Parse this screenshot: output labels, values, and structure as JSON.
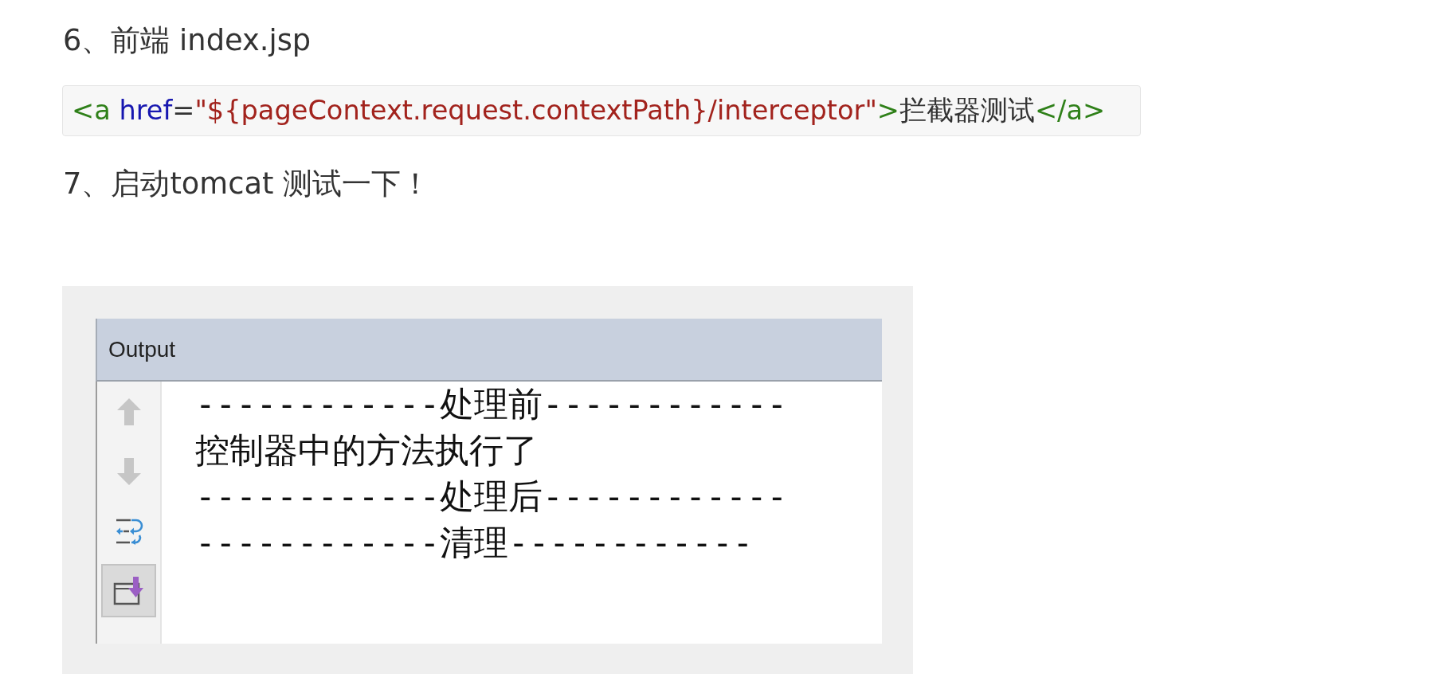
{
  "sections": [
    {
      "heading": "6、前端 index.jsp",
      "code": [
        {
          "kind": "tag",
          "text": "<a"
        },
        {
          "kind": "attr",
          "text": " href"
        },
        {
          "kind": "text",
          "text": "="
        },
        {
          "kind": "string",
          "text": "\"${pageContext.request.contextPath}/interceptor\""
        },
        {
          "kind": "tag",
          "text": ">"
        },
        {
          "kind": "text",
          "text": "拦截器测试"
        },
        {
          "kind": "tag",
          "text": "</a>"
        }
      ]
    },
    {
      "heading": "7、启动tomcat 测试一下！",
      "output_window": {
        "title": "Output",
        "toolbar": [
          {
            "kind": "up",
            "disabled": true,
            "on": false
          },
          {
            "kind": "down",
            "disabled": true,
            "on": false
          },
          {
            "kind": "wrap",
            "disabled": false,
            "on": false
          },
          {
            "kind": "autoscroll",
            "disabled": false,
            "on": true
          }
        ],
        "lines": [
          "------------处理前------------",
          "控制器中的方法执行了",
          "------------处理后------------",
          "------------清理------------"
        ]
      }
    }
  ]
}
